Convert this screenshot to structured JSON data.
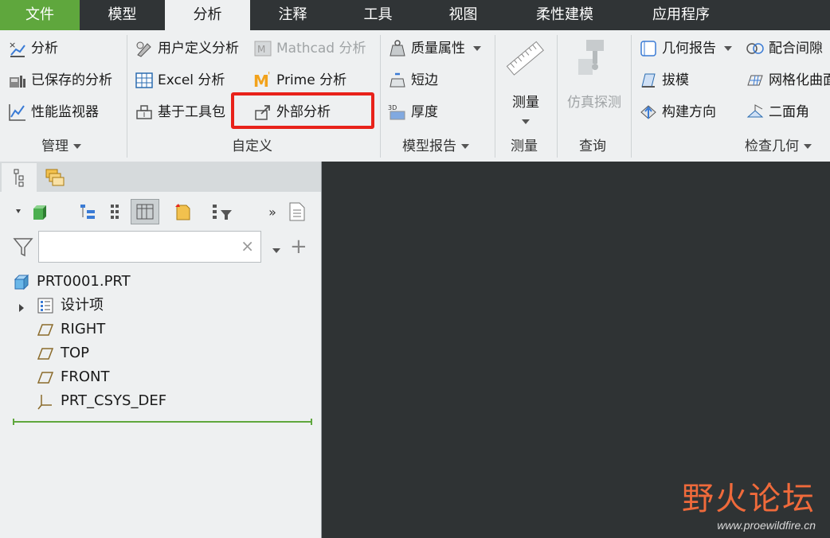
{
  "tabs": [
    {
      "label": "文件"
    },
    {
      "label": "模型"
    },
    {
      "label": "分析"
    },
    {
      "label": "注释"
    },
    {
      "label": "工具"
    },
    {
      "label": "视图"
    },
    {
      "label": "柔性建模"
    },
    {
      "label": "应用程序"
    }
  ],
  "active_tab": "分析",
  "ribbon": {
    "manage": {
      "items": [
        "分析",
        "已保存的分析",
        "性能监视器"
      ],
      "label": "管理"
    },
    "custom": {
      "col1": [
        "用户定义分析",
        "Excel 分析",
        "基于工具包"
      ],
      "col2": [
        "Mathcad 分析",
        "Prime 分析",
        "外部分析"
      ],
      "label": "自定义"
    },
    "model_report": {
      "items": [
        "质量属性",
        "短边",
        "厚度"
      ],
      "label": "模型报告"
    },
    "measure": {
      "button": "测量",
      "label": "测量"
    },
    "query": {
      "button": "仿真探测",
      "label": "查询"
    },
    "inspect": {
      "col1": [
        "几何报告",
        "拔模",
        "构建方向"
      ],
      "col2": [
        "配合间隙",
        "网格化曲面",
        "二面角"
      ],
      "label": "检查几何"
    }
  },
  "panel": {
    "filter": {
      "value": "",
      "placeholder": ""
    },
    "tree": {
      "root": "PRT0001.PRT",
      "items": [
        "设计项",
        "RIGHT",
        "TOP",
        "FRONT",
        "PRT_CSYS_DEF"
      ]
    }
  },
  "watermark": {
    "title": "野火论坛",
    "url": "www.proewildfire.cn"
  },
  "colors": {
    "file_tab": "#5fa73d",
    "highlight": "#e8221a",
    "graphics_bg": "#2f3334",
    "watermark": "#ef6a3b"
  }
}
